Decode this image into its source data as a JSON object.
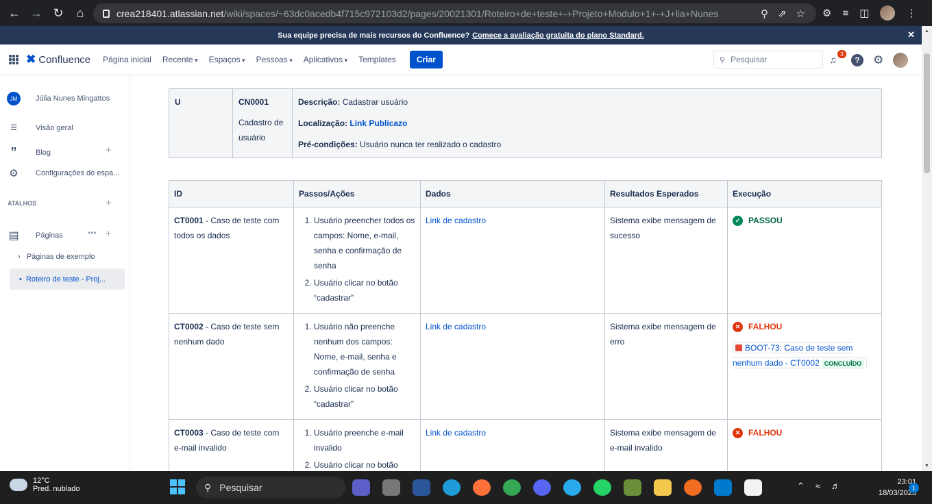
{
  "browser": {
    "url_host": "crea218401.atlassian.net",
    "url_path": "/wiki/spaces/~63dc0acedb4f715c972103d2/pages/20021301/Roteiro+de+teste+-+Projeto+Modulo+1+-+J+lia+Nunes"
  },
  "banner": {
    "text": "Sua equipe precisa de mais recursos do Confluence?",
    "link": "Comece a avaliação gratuita do plano Standard."
  },
  "topnav": {
    "logo": "Confluence",
    "menu": [
      "Página inicial",
      "Recente",
      "Espaços",
      "Pessoas",
      "Aplicativos",
      "Templates"
    ],
    "create": "Criar",
    "search_placeholder": "Pesquisar",
    "notifications": "3"
  },
  "sidebar": {
    "user_initials": "JM",
    "user_name": "Júlia Nunes Mingattos",
    "overview": "Visão geral",
    "blog": "Blog",
    "settings": "Configurações do espa...",
    "shortcuts": "ATALHOS",
    "pages": "Páginas",
    "tree": [
      "Páginas de exemplo",
      "Roteiro de teste - Proj..."
    ]
  },
  "usecase": {
    "col1": "U",
    "code": "CN0001",
    "name": "Cadastro de usuário",
    "desc_label": "Descrição:",
    "desc": "Cadastrar usuário",
    "loc_label": "Localização:",
    "loc": "Link Publicazo",
    "pre_label": "Pré-condições:",
    "pre": "Usuário nunca ter realizado o cadastro"
  },
  "tests": {
    "headers": [
      "ID",
      "Passos/Ações",
      "Dados",
      "Resultados Esperados",
      "Execução"
    ],
    "rows": [
      {
        "id": "CT0001",
        "title": " - Caso de teste com todos os dados",
        "steps": [
          "Usuário preencher todos os campos: Nome, e-mail, senha e confirmação de senha",
          "Usuário clicar no botão “cadastrar”"
        ],
        "data": "Link de cadastro",
        "expected": "Sistema exibe mensagem de sucesso",
        "result": "PASSOU"
      },
      {
        "id": "CT0002",
        "title": " - Caso de teste sem nenhum dado",
        "steps": [
          "Usuário não preenche nenhum dos campos: Nome, e-mail, senha e confirmação de senha",
          "Usuário clicar no botão “cadastrar”"
        ],
        "data": "Link de cadastro",
        "expected": "Sistema exibe mensagem de erro",
        "result": "FALHOU",
        "issue": "BOOT-73: Caso de teste sem nenhum dado - CT0002",
        "issue_status": "CONCLUÍDO"
      },
      {
        "id": "CT0003",
        "title": " - Caso de teste com e-mail invalido",
        "steps": [
          "Usuário preenche e-mail invalido",
          "Usuário clicar no botão “cadastrar”"
        ],
        "data": "Link de cadastro",
        "expected": "Sistema exibe mensagem de e-mail invalido",
        "result": "FALHOU"
      }
    ]
  },
  "taskbar": {
    "temp": "12°C",
    "weather": "Pred. nublado",
    "search": "Pesquisar",
    "time": "23:01",
    "date": "18/03/2023",
    "notif": "1"
  }
}
